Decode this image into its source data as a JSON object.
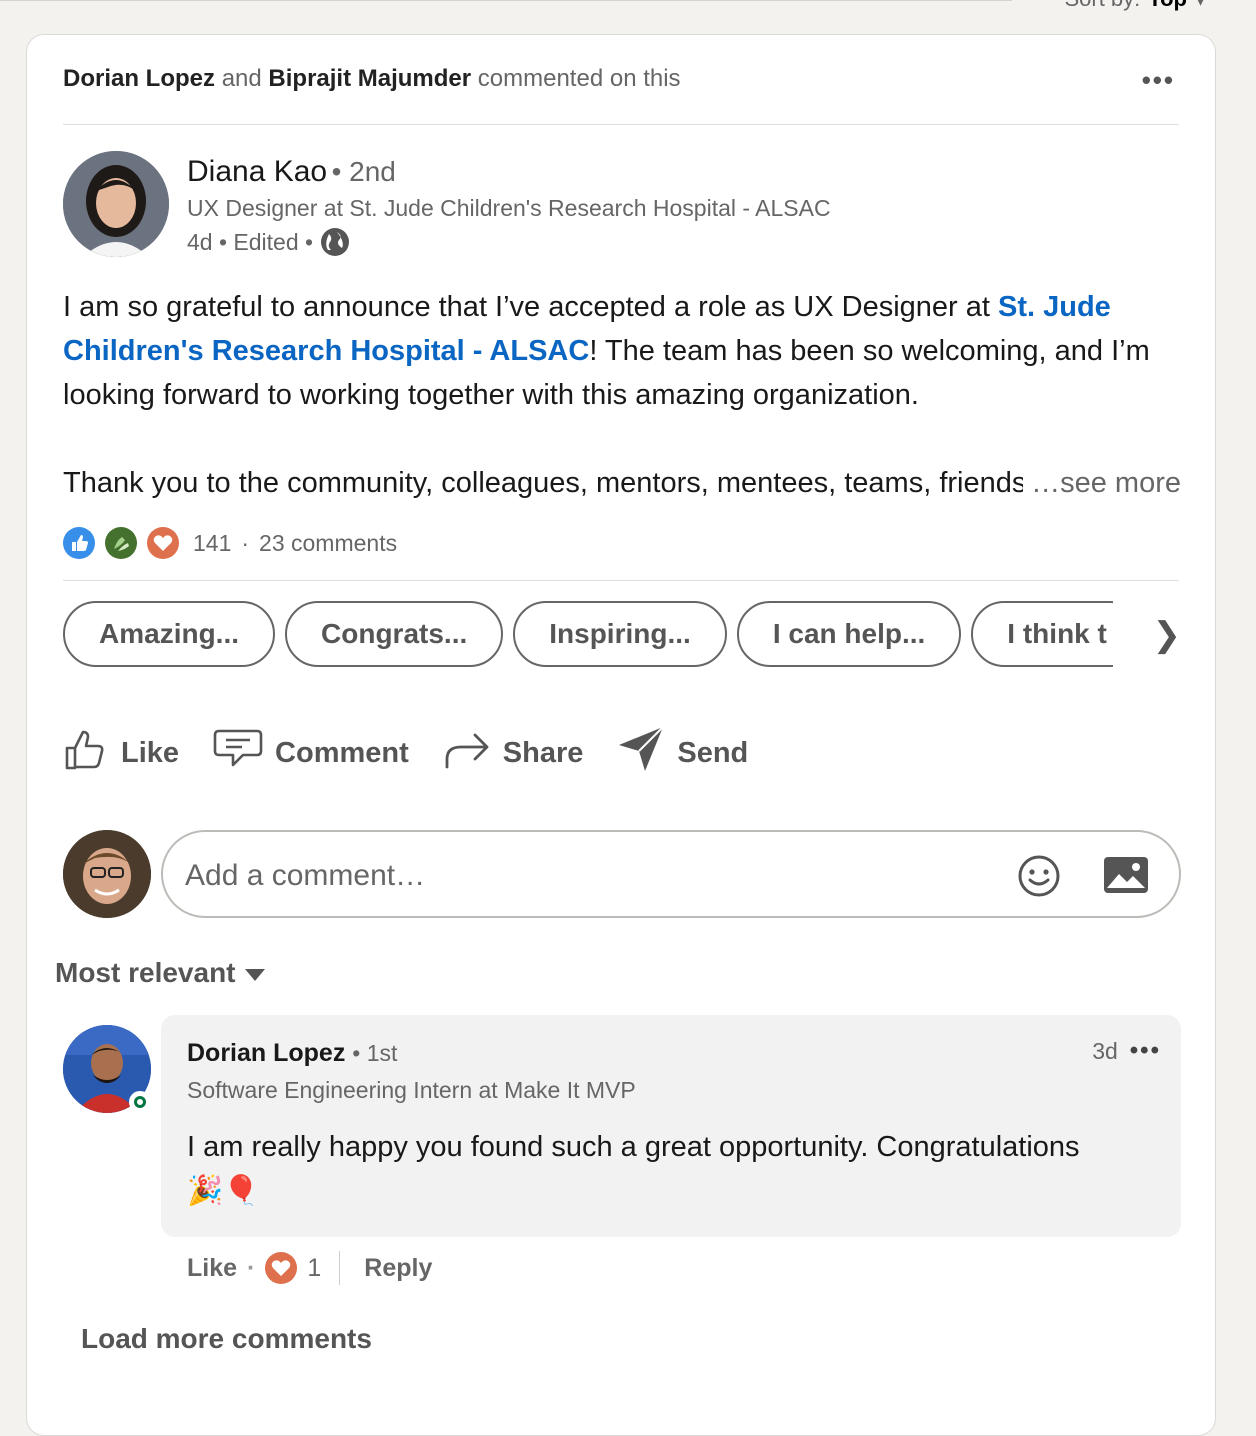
{
  "sort_bar": {
    "label": "Sort by:",
    "value": "Top"
  },
  "context": {
    "name1": "Dorian Lopez",
    "joiner": "and",
    "name2": "Biprajit Majumder",
    "suffix": "commented on this"
  },
  "author": {
    "name": "Diana Kao",
    "degree": "• 2nd",
    "headline": "UX Designer at St. Jude Children's Research Hospital - ALSAC",
    "meta": "4d • Edited •"
  },
  "post": {
    "part1": "I am so grateful to announce that I’ve accepted a role as UX Designer at ",
    "link": "St. Jude Children's Research Hospital - ALSAC",
    "part2": "! The team has been so welcoming, and I’m looking forward to working together with this amazing organization.",
    "line3": "Thank you to the community, colleagues, mentors, mentees, teams, friends",
    "see_more": "…see more"
  },
  "social": {
    "reactions_count": "141",
    "dot": "·",
    "comments": "23 comments"
  },
  "chips": [
    "Amazing...",
    "Congrats...",
    "Inspiring...",
    "I can help...",
    "I think t"
  ],
  "actions": {
    "like": "Like",
    "comment": "Comment",
    "share": "Share",
    "send": "Send"
  },
  "comment_input": {
    "placeholder": "Add a comment…"
  },
  "sort": {
    "label": "Most relevant"
  },
  "comment": {
    "name": "Dorian Lopez",
    "degree": "• 1st",
    "time": "3d",
    "headline": "Software Engineering Intern at Make It MVP",
    "text": "I am really happy you found such a great opportunity. Congratulations",
    "emojis": "🎉🎈",
    "like": "Like",
    "dot": "·",
    "reaction_count": "1",
    "reply": "Reply"
  },
  "load_more": "Load more comments",
  "colors": {
    "link": "#0a66c2",
    "like_blue": "#378fe9",
    "celebrate_green": "#44712e",
    "love_orange": "#df704d",
    "online_green": "#057642"
  }
}
